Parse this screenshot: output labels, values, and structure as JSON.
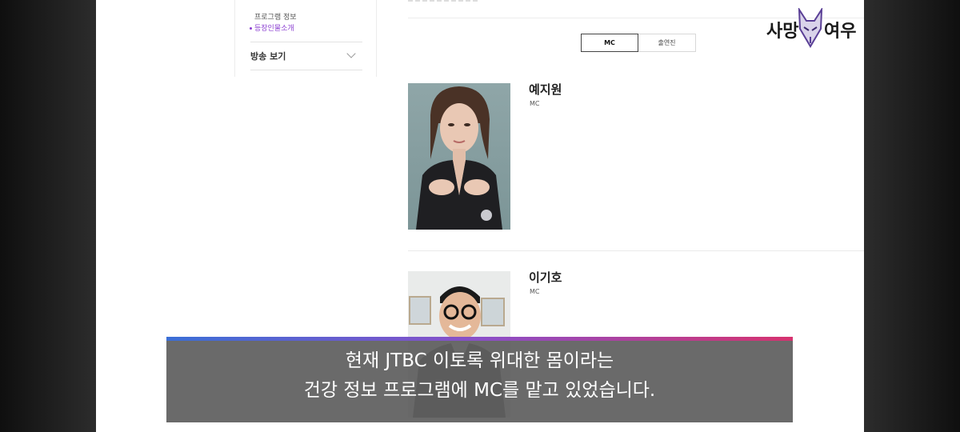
{
  "sidebar": {
    "sub_items": [
      "프로그램 정보",
      "등장인물소개"
    ],
    "watch_menu": "방송 보기"
  },
  "tabs": [
    "MC",
    "출연진"
  ],
  "active_tab": "MC",
  "people": [
    {
      "name": "예지원",
      "role": "MC"
    },
    {
      "name": "이기호",
      "role": "MC"
    }
  ],
  "logo": {
    "left_text": "사망",
    "right_text": "여우"
  },
  "subtitle": {
    "line1": "현재 JTBC 이토록 위대한 몸이라는",
    "line2": "건강 정보 프로그램에 MC를 맡고 있었습니다."
  },
  "colors": {
    "accent_purple": "#8b3fd1",
    "subtitle_bar_start": "#3b6fd6",
    "subtitle_bar_end": "#d6336f"
  }
}
